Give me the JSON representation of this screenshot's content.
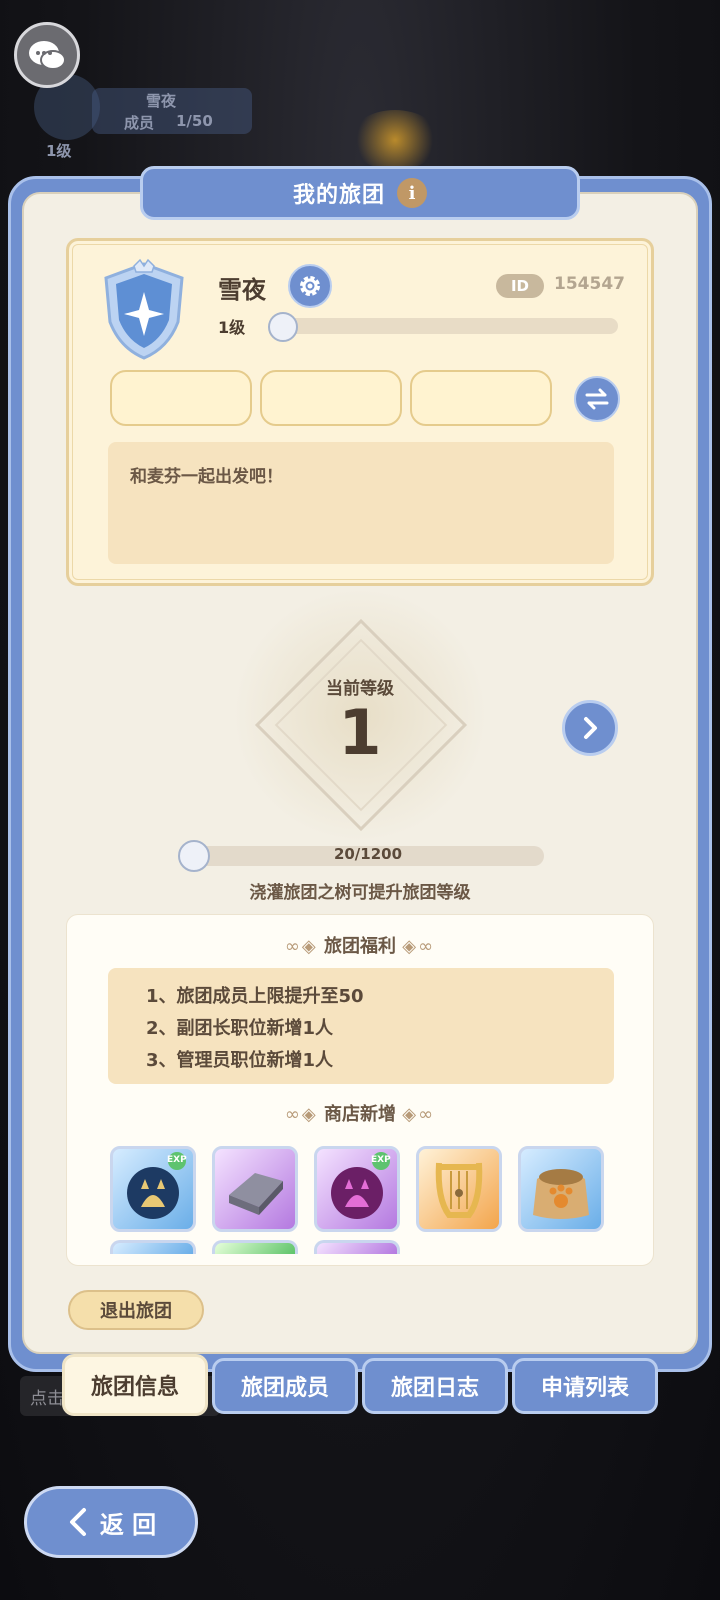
{
  "background": {
    "guild_name": "雪夜",
    "members_label": "成员",
    "members_count": "1/50",
    "level": "1级",
    "tap_hint": "点击"
  },
  "header": {
    "title": "我的旅团",
    "info_icon": "i"
  },
  "guild": {
    "name": "雪夜",
    "id_label": "ID",
    "id_value": "154547",
    "level_text": "1级",
    "motto": "和麦芬一起出发吧！"
  },
  "level_section": {
    "current_label": "当前等级",
    "current_level": "1",
    "exp_text": "20/1200",
    "exp_progress": 0.0167,
    "hint": "浇灌旅团之树可提升旅团等级"
  },
  "benefits": {
    "title": "旅团福利",
    "lines": [
      "1、旅团成员上限提升至50",
      "2、副团长职位新增1人",
      "3、管理员职位新增1人"
    ]
  },
  "shop": {
    "title": "商店新增",
    "items": [
      {
        "icon": "cat-exp-potion-blue-icon",
        "badge": "EXP"
      },
      {
        "icon": "silver-ingot-icon",
        "badge": ""
      },
      {
        "icon": "cat-exp-potion-purple-icon",
        "badge": "EXP"
      },
      {
        "icon": "lyre-icon",
        "badge": ""
      },
      {
        "icon": "paw-food-bag-icon",
        "badge": ""
      }
    ]
  },
  "actions": {
    "quit": "退出旅团",
    "back": "返 回"
  },
  "tabs": [
    {
      "label": "旅团信息",
      "active": true
    },
    {
      "label": "旅团成员",
      "active": false
    },
    {
      "label": "旅团日志",
      "active": false
    },
    {
      "label": "申请列表",
      "active": false
    }
  ],
  "colors": {
    "accent_blue": "#6f8fcf",
    "panel_bg": "#f3efe4",
    "card_bg": "#fdf3d9"
  }
}
